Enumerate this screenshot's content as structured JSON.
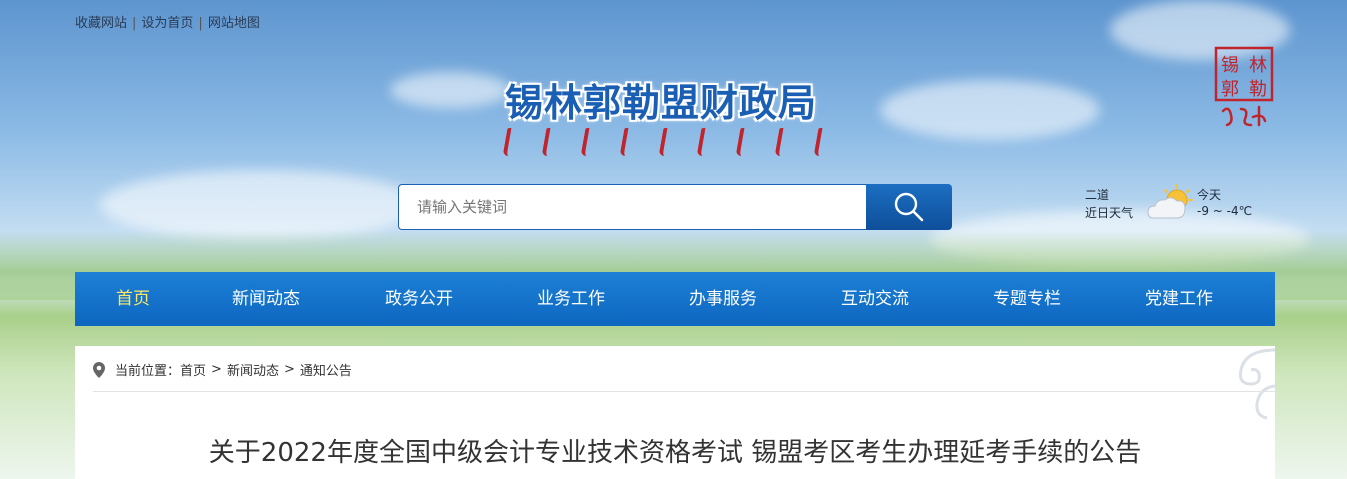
{
  "top_links": [
    "收藏网站",
    "设为首页",
    "网站地图"
  ],
  "top_link_separator": "|",
  "site_title": "锡林郭勒盟财政局",
  "seal_text": [
    "锡",
    "林",
    "郭",
    "勒"
  ],
  "search": {
    "placeholder": "请输入关键词",
    "button_icon": "search-icon"
  },
  "weather": {
    "location": "二道",
    "label": "近日天气",
    "day": "今天",
    "temp": "-9 ~ -4℃",
    "icon": "partly-cloudy-icon"
  },
  "nav": {
    "items": [
      "首页",
      "新闻动态",
      "政务公开",
      "业务工作",
      "办事服务",
      "互动交流",
      "专题专栏",
      "党建工作"
    ],
    "active_index": 0
  },
  "breadcrumb": {
    "prefix": "当前位置：",
    "items": [
      "首页",
      "新闻动态",
      "通知公告"
    ],
    "separator": ">"
  },
  "article": {
    "title": "关于2022年度全国中级会计专业技术资格考试 锡盟考区考生办理延考手续的公告"
  },
  "colors": {
    "nav_bg": "#0d66bf",
    "nav_active": "#ffe866",
    "title_blue": "#1a5fb4",
    "seal_red": "#c0242c"
  }
}
